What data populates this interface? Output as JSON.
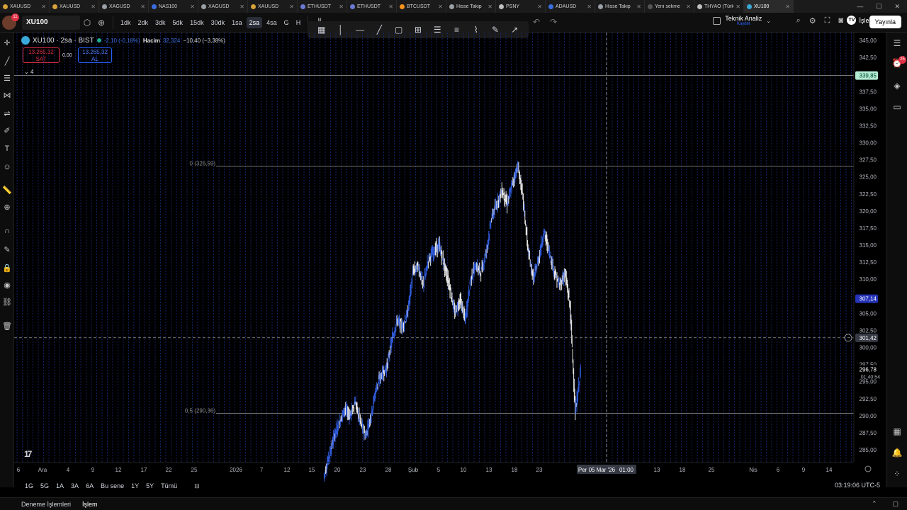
{
  "browser": {
    "tabs": [
      {
        "label": "XAUUSD",
        "color": "#d6a23a"
      },
      {
        "label": "XAUUSD",
        "color": "#d6a23a"
      },
      {
        "label": "XAGUSD",
        "color": "#9aa0a6"
      },
      {
        "label": "NAS100",
        "color": "#3a6ee0"
      },
      {
        "label": "XAGUSD",
        "color": "#9aa0a6"
      },
      {
        "label": "XAUUSD",
        "color": "#d6a23a"
      },
      {
        "label": "ETHUSDT",
        "color": "#6a7bd6"
      },
      {
        "label": "ETHUSDT",
        "color": "#6a7bd6"
      },
      {
        "label": "BTCUSDT",
        "color": "#f7931a"
      },
      {
        "label": "Hisse Takip",
        "color": "#9aa0a6"
      },
      {
        "label": "PSNY",
        "color": "#c0c0c0"
      },
      {
        "label": "ADAUSD",
        "color": "#3a6ee0"
      },
      {
        "label": "Hisse Takip",
        "color": "#9aa0a6"
      },
      {
        "label": "Yeni sekme",
        "color": "#555555"
      },
      {
        "label": "THYAO (Türk Ha",
        "color": "#c0c0c0"
      },
      {
        "label": "XU100",
        "color": "#3aa9d9"
      }
    ],
    "active_tab_index": 15
  },
  "toolbar": {
    "user_badge": "11",
    "symbol": "XU100",
    "intervals": [
      "1dk",
      "2dk",
      "3dk",
      "5dk",
      "15dk",
      "30dk",
      "1sa",
      "2sa",
      "4sa",
      "G",
      "H"
    ],
    "active_interval": "2sa",
    "technical_analysis_label": "Teknik Analiz",
    "technical_analysis_sub": "Kaydet",
    "trade_label": "İşlem",
    "publish_label": "Yayınla"
  },
  "legend": {
    "title": "XU100 · 2sa · BIST",
    "change": "-2,10 (-0,18%)",
    "volume_label": "Hacim",
    "volume_value": "32,324",
    "volume_change": "−10,40 (−3,38%)",
    "sell_price": "13.265,32",
    "sell_label": "SAT",
    "spread": "0,00",
    "buy_price": "13.265,32",
    "buy_label": "AL",
    "indicator_count": "4"
  },
  "chart_data": {
    "type": "candlestick",
    "symbol": "XU100",
    "interval": "2sa",
    "price_axis": [
      "345,00",
      "342,50",
      "337,50",
      "335,00",
      "332,50",
      "330,00",
      "327,50",
      "325,00",
      "322,50",
      "320,00",
      "317,50",
      "315,00",
      "312,50",
      "310,00",
      "305,00",
      "302,50",
      "300,00",
      "297,50",
      "295,00",
      "292,50",
      "290,00",
      "287,50",
      "285,00"
    ],
    "time_axis": [
      "6",
      "Ara",
      "4",
      "9",
      "12",
      "17",
      "22",
      "25",
      "2026",
      "7",
      "12",
      "15",
      "20",
      "23",
      "28",
      "Şub",
      "5",
      "10",
      "13",
      "18",
      "23",
      "Per 05 Mar '26",
      "01:00",
      "13",
      "18",
      "25",
      "Nis",
      "6",
      "9",
      "14"
    ],
    "ylim": [
      283,
      346
    ],
    "close_path": [
      [
        -1,
        281
      ],
      [
        0,
        284
      ],
      [
        1,
        287
      ],
      [
        2,
        289
      ],
      [
        3,
        291
      ],
      [
        4,
        290
      ],
      [
        5,
        292
      ],
      [
        6,
        289
      ],
      [
        7,
        287
      ],
      [
        8,
        290
      ],
      [
        9,
        294
      ],
      [
        10,
        296
      ],
      [
        11,
        297
      ],
      [
        12,
        301
      ],
      [
        13,
        304
      ],
      [
        14,
        303
      ],
      [
        15,
        305
      ],
      [
        16,
        311
      ],
      [
        17,
        312
      ],
      [
        18,
        309
      ],
      [
        19,
        313
      ],
      [
        20,
        314
      ],
      [
        21,
        315
      ],
      [
        22,
        312
      ],
      [
        23,
        309
      ],
      [
        24,
        305
      ],
      [
        25,
        307
      ],
      [
        26,
        304
      ],
      [
        27,
        310
      ],
      [
        28,
        312
      ],
      [
        29,
        311
      ],
      [
        30,
        314
      ],
      [
        31,
        319
      ],
      [
        32,
        321
      ],
      [
        33,
        323
      ],
      [
        34,
        321
      ],
      [
        35,
        324
      ],
      [
        36,
        326.6
      ],
      [
        37,
        322
      ],
      [
        38,
        314
      ],
      [
        39,
        310
      ],
      [
        40,
        313
      ],
      [
        41,
        317
      ],
      [
        42,
        314
      ],
      [
        43,
        311
      ],
      [
        44,
        309
      ],
      [
        45,
        311
      ],
      [
        46,
        306
      ],
      [
        47,
        290.3
      ],
      [
        48,
        296.8
      ]
    ],
    "horizontal_lines": [
      {
        "price": "339,85",
        "label": "339,85"
      },
      {
        "price": "326,59",
        "label": "0 (326,59)"
      },
      {
        "price": "290,36",
        "label": "0,5 (290,36)"
      }
    ],
    "price_tags": [
      {
        "label": "339,85",
        "price": 339.85,
        "bg": "#b2ebd2",
        "fg": "#064a32"
      },
      {
        "label": "307,14",
        "price": 307.14,
        "bg": "#2433b8",
        "fg": "#ffffff"
      },
      {
        "label": "301,42",
        "price": 301.42,
        "bg": "#363a45",
        "fg": "#ffffff"
      },
      {
        "label": "296,78",
        "price": 296.78,
        "bg": "#000000",
        "fg": "#ffffff"
      }
    ],
    "countdown": "01:40:54",
    "crosshair_time_label": "Per 05 Mar '26",
    "crosshair_hour_label": "01:00"
  },
  "ranges": [
    "1G",
    "5G",
    "1A",
    "3A",
    "6A",
    "Bu sene",
    "1Y",
    "5Y",
    "Tümü"
  ],
  "timezone": "03:19:06 UTC-5",
  "bottom": {
    "tab1": "Deneme İşlemleri",
    "tab2": "İşlem"
  },
  "colors": {
    "bar_blue": "#2f5bdc",
    "bar_white": "#e6e6e6",
    "vertical_grid": "#1c2a78"
  },
  "notification_badge": "25"
}
